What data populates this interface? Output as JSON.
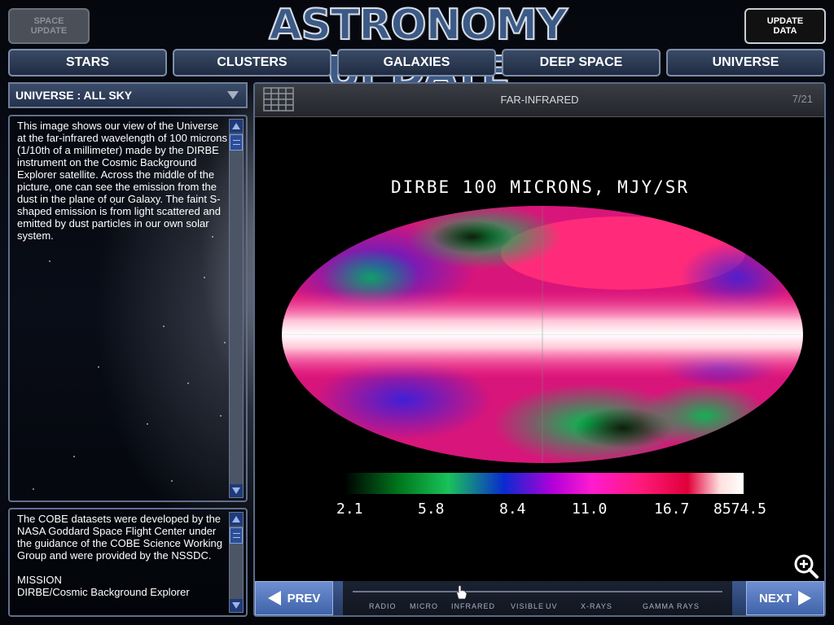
{
  "header": {
    "title": "ASTRONOMY UPDATE",
    "left_button": "SPACE\nUPDATE",
    "right_button": "UPDATE\nDATA"
  },
  "nav_tabs": [
    "STARS",
    "CLUSTERS",
    "GALAXIES",
    "DEEP SPACE",
    "UNIVERSE"
  ],
  "category_select": {
    "value": "UNIVERSE : ALL SKY"
  },
  "description": {
    "text": "This image shows our view of the Universe at the far-infrared wavelength of 100 microns (1/10th of a millimeter) made by the DIRBE instrument on the Cosmic Background Explorer satellite. Across the middle of the picture, one can see the emission from the dust in the plane of our Galaxy. The faint S-shaped emission is from light scattered and emitted by dust particles in our own solar system."
  },
  "credits": {
    "text": "The COBE datasets were developed by the NASA Goddard Space Flight Center under the guidance of the COBE Science Working Group and were provided by the NSSDC.\n\nMISSION\nDIRBE/Cosmic Background Explorer"
  },
  "viewer": {
    "image_title": "FAR-INFRARED",
    "counter": "7/21",
    "map_title": "DIRBE 100 MICRONS, MJY/SR",
    "color_scale_labels": [
      "2.1",
      "5.8",
      "8.4",
      "11.0",
      "16.7",
      "8574.5"
    ]
  },
  "footer": {
    "prev_label": "PREV",
    "next_label": "NEXT",
    "spectrum": [
      "RADIO",
      "MICRO",
      "INFRARED",
      "VISIBLE",
      "UV",
      "X-RAYS",
      "GAMMA RAYS"
    ],
    "spectrum_selected": "INFRARED"
  },
  "colors": {
    "accent": "#3f63aa",
    "panel_border": "#5f6f8c",
    "nav_bg": "#24324c"
  },
  "icons": [
    "grid-icon",
    "zoom-in-icon",
    "hand-cursor-icon",
    "prev-arrow-icon",
    "next-arrow-icon",
    "dropdown-arrow-icon"
  ]
}
